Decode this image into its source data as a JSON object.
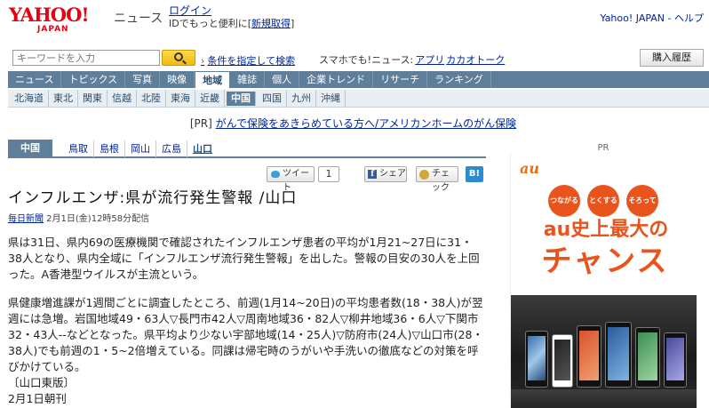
{
  "header": {
    "logo_main": "YAHOO!",
    "logo_sub": "JAPAN",
    "section_title": "ニュース",
    "login_link": "ログイン",
    "login_desc": "IDでもっと便利に[",
    "register_link": "新規取得",
    "login_desc_end": "]",
    "top_right": "Yahoo! JAPAN - ヘルプ"
  },
  "search": {
    "placeholder": "キーワードを入力",
    "advanced_link": "条件を指定して検索",
    "sp_text": "スマホでも!ニュース:",
    "app_link": "アプリ",
    "kakao_link": "カカオトーク",
    "purchase_label": "購入履歴"
  },
  "main_nav": [
    {
      "label": "ニュース"
    },
    {
      "label": "トピックス"
    },
    {
      "label": "写真"
    },
    {
      "label": "映像"
    },
    {
      "label": "地域",
      "active": true
    },
    {
      "label": "雑誌"
    },
    {
      "label": "個人"
    },
    {
      "label": "企業トレンド"
    },
    {
      "label": "リサーチ"
    },
    {
      "label": "ランキング"
    }
  ],
  "sub_nav": [
    {
      "label": "北海道"
    },
    {
      "label": "東北"
    },
    {
      "label": "関東"
    },
    {
      "label": "信越"
    },
    {
      "label": "北陸"
    },
    {
      "label": "東海"
    },
    {
      "label": "近畿"
    },
    {
      "label": "中国",
      "active": true
    },
    {
      "label": "四国"
    },
    {
      "label": "九州"
    },
    {
      "label": "沖縄"
    }
  ],
  "pr_line": {
    "prefix": "[PR] ",
    "link": "がんで保険をあきらめている方へ/アメリカンホームのがん保険"
  },
  "pref_tabs": {
    "region": "中国",
    "items": [
      "鳥取",
      "島根",
      "岡山",
      "広島",
      "山口"
    ],
    "current": "山口"
  },
  "social": {
    "tweet": "ツイート",
    "tweet_count": "1",
    "share": "シェア",
    "share_icon": "f",
    "check": "チェック",
    "hatena": "B!"
  },
  "article": {
    "headline": "インフルエンザ:県が流行発生警報 /山口",
    "source": "毎日新聞",
    "date": " 2月1日(金)12時58分配信",
    "p1": "県は31日、県内69の医療機関で確認されたインフルエンザ患者の平均が1月21~27日に31・38人となり、県内全域に「インフルエンザ流行発生警報」を出した。警報の目安の30人を上回った。A香港型ウイルスが主流という。",
    "p2": "県健康増進課が1週間ごとに調査したところ、前週(1月14~20日)の平均患者数(18・38人)が翌週には急増。岩国地域49・63人▽長門市42人▽周南地域36・82人▽柳井地域36・6人▽下関市32・43人--などとなった。県平均より少ない宇部地域(14・25人)▽防府市(24人)▽山口市(28・38人)でも前週の1・5~2倍増えている。同課は帰宅時のうがいや手洗いの徹底などの対策を呼びかけている。",
    "edition": "〔山口東版〕",
    "paper_date": "2月1日朝刊"
  },
  "ad": {
    "label": "PR",
    "logo": "au",
    "circles": [
      "つながる",
      "とくする",
      "そろってる"
    ],
    "headline": "au史上最大の",
    "big": "チャンス"
  }
}
